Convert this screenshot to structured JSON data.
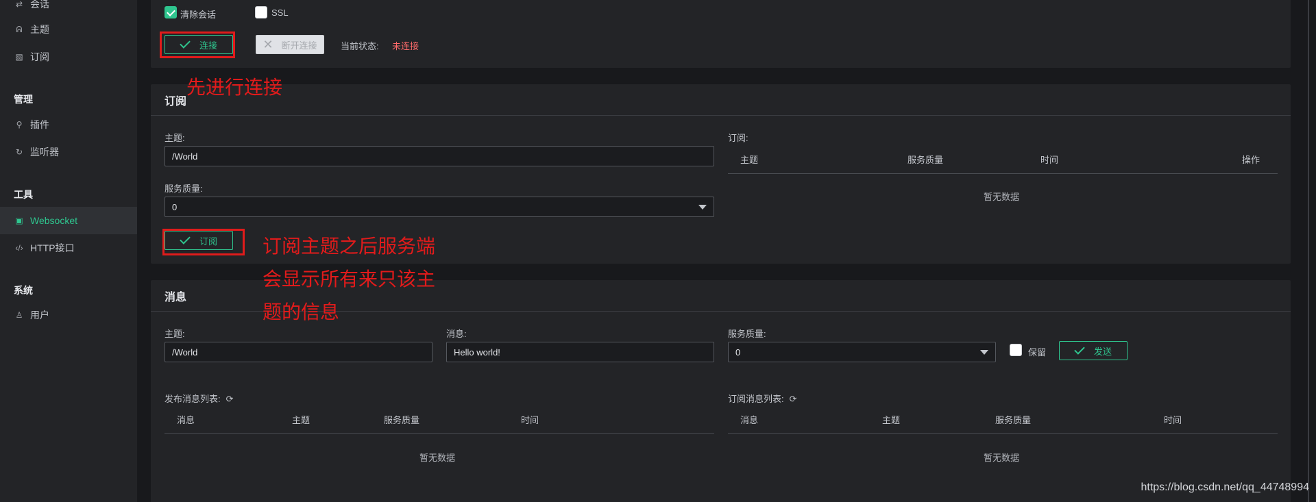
{
  "sidebar": {
    "items": [
      {
        "label": "会话",
        "icon": "swap-icon"
      },
      {
        "label": "主题",
        "icon": "topic-icon"
      },
      {
        "label": "订阅",
        "icon": "rss-icon"
      }
    ],
    "groups": [
      "管理",
      "工具",
      "系统"
    ],
    "manage_items": [
      {
        "label": "插件",
        "icon": "plug-icon"
      },
      {
        "label": "监听器",
        "icon": "listener-icon"
      }
    ],
    "tool_items": [
      {
        "label": "Websocket",
        "icon": "html5-icon",
        "active": true
      },
      {
        "label": "HTTP接口",
        "icon": "code-icon"
      }
    ],
    "system_items": [
      {
        "label": "用户",
        "icon": "user-icon"
      }
    ]
  },
  "connect": {
    "clean_session_label": "清除会话",
    "ssl_label": "SSL",
    "connect_label": "连接",
    "disconnect_label": "断开连接",
    "status_label": "当前状态:",
    "status_value": "未连接"
  },
  "annotations": {
    "connect_first": "先进行连接",
    "subscribe_line1": "订阅主题之后服务端",
    "subscribe_line2": "会显示所有来只该主",
    "subscribe_line3": "题的信息"
  },
  "subscribe": {
    "title": "订阅",
    "topic_label": "主题:",
    "topic_value": "/World",
    "qos_label": "服务质量:",
    "qos_value": "0",
    "subscribe_label": "订阅",
    "list_label": "订阅:",
    "columns": [
      "主题",
      "服务质量",
      "时间",
      "操作"
    ],
    "empty": "暂无数据"
  },
  "message": {
    "title": "消息",
    "topic_label": "主题:",
    "topic_value": "/World",
    "message_label": "消息:",
    "message_value": "Hello world!",
    "qos_label": "服务质量:",
    "qos_value": "0",
    "retain_label": "保留",
    "send_label": "发送",
    "published_label": "发布消息列表:",
    "published_columns": [
      "消息",
      "主题",
      "服务质量",
      "时间"
    ],
    "published_empty": "暂无数据",
    "received_label": "订阅消息列表:",
    "received_columns": [
      "消息",
      "主题",
      "服务质量",
      "时间"
    ],
    "received_empty": "暂无数据"
  },
  "watermark": "https://blog.csdn.net/qq_44748994",
  "colors": {
    "accent": "#2fc68f",
    "annotation": "#e11b1b",
    "status_disconnected": "#ff6b6b"
  }
}
